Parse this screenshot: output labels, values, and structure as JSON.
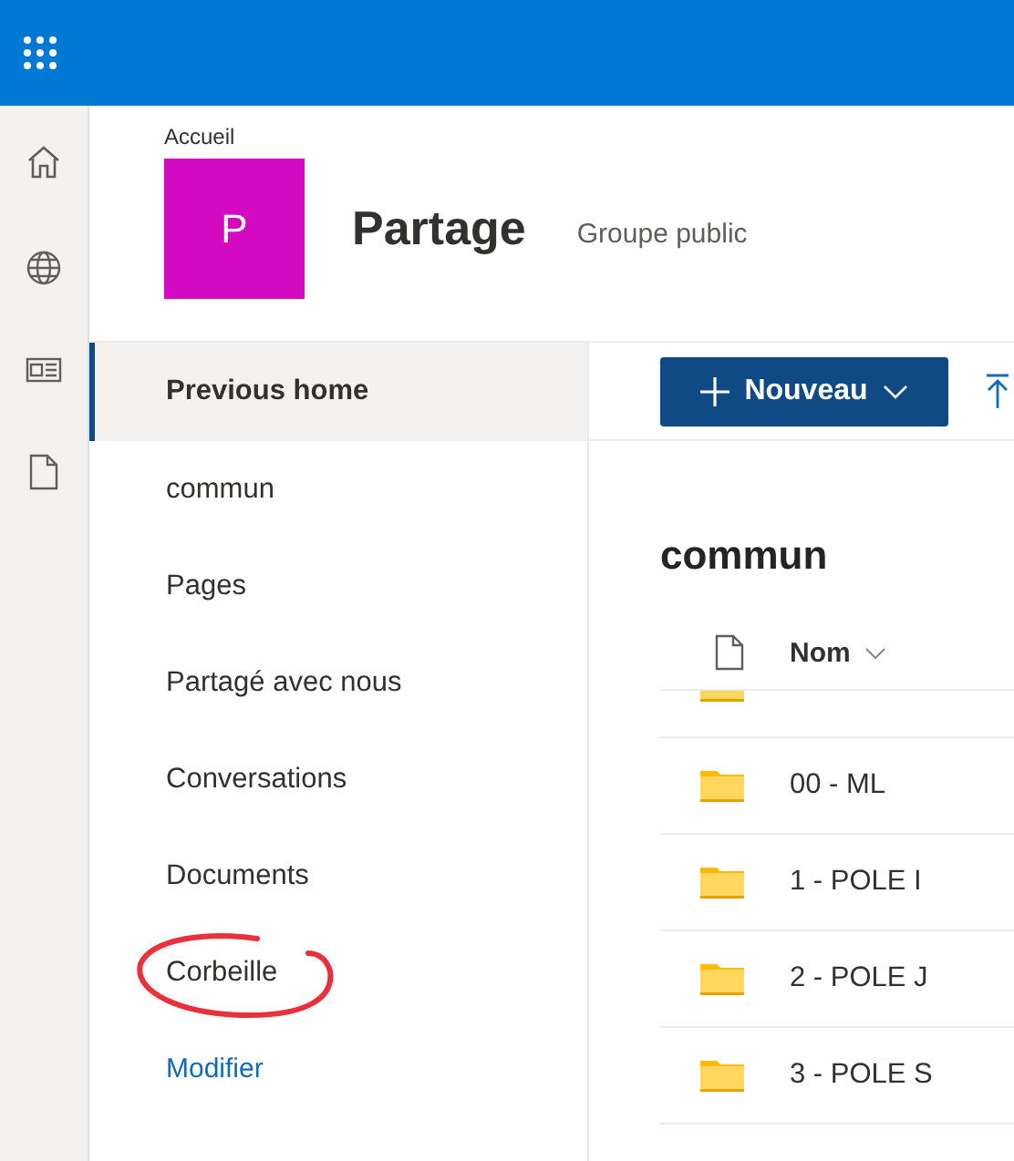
{
  "breadcrumb": "Accueil",
  "site": {
    "logo_letter": "P",
    "title": "Partage",
    "subtitle": "Groupe public"
  },
  "nav": {
    "items": [
      {
        "label": "Previous home",
        "selected": true,
        "circled": false
      },
      {
        "label": "commun",
        "selected": false,
        "circled": false
      },
      {
        "label": "Pages",
        "selected": false,
        "circled": false
      },
      {
        "label": "Partagé avec nous",
        "selected": false,
        "circled": false
      },
      {
        "label": "Conversations",
        "selected": false,
        "circled": false
      },
      {
        "label": "Documents",
        "selected": false,
        "circled": false
      },
      {
        "label": "Corbeille",
        "selected": false,
        "circled": true
      }
    ],
    "edit_link": "Modifier"
  },
  "toolbar": {
    "new_button": "Nouveau"
  },
  "library": {
    "title": "commun",
    "columns": [
      {
        "kind": "icon"
      },
      {
        "kind": "text",
        "label": "Nom"
      }
    ],
    "rows": [
      {
        "kind": "partial"
      },
      {
        "kind": "folder",
        "name": "00 - ML"
      },
      {
        "kind": "folder",
        "name": "1 - POLE I"
      },
      {
        "kind": "folder",
        "name": "2 - POLE J"
      },
      {
        "kind": "folder",
        "name": "3 - POLE S"
      }
    ]
  }
}
